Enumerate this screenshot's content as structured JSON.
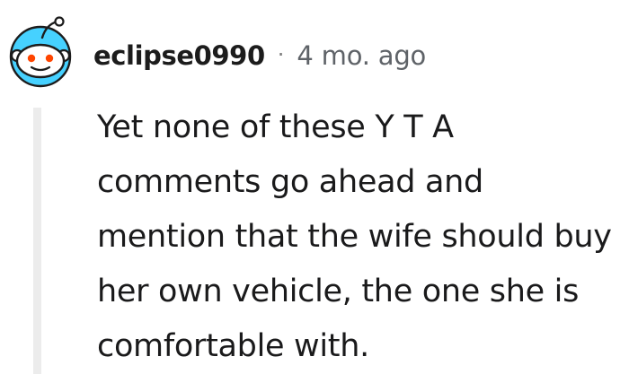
{
  "comment": {
    "author": "eclipse0990",
    "separator": "·",
    "timestamp": "4 mo. ago",
    "body": "Yet none of these Y T A comments go ahead and mention that the wife should buy her own vehicle, the one she is comfortable with.",
    "avatar_icon": "reddit-snoo-icon"
  },
  "colors": {
    "avatar_background": "#46d1ff",
    "thread_line": "#ececec",
    "meta_text": "#5f6368",
    "body_text": "#1a1a1b"
  }
}
